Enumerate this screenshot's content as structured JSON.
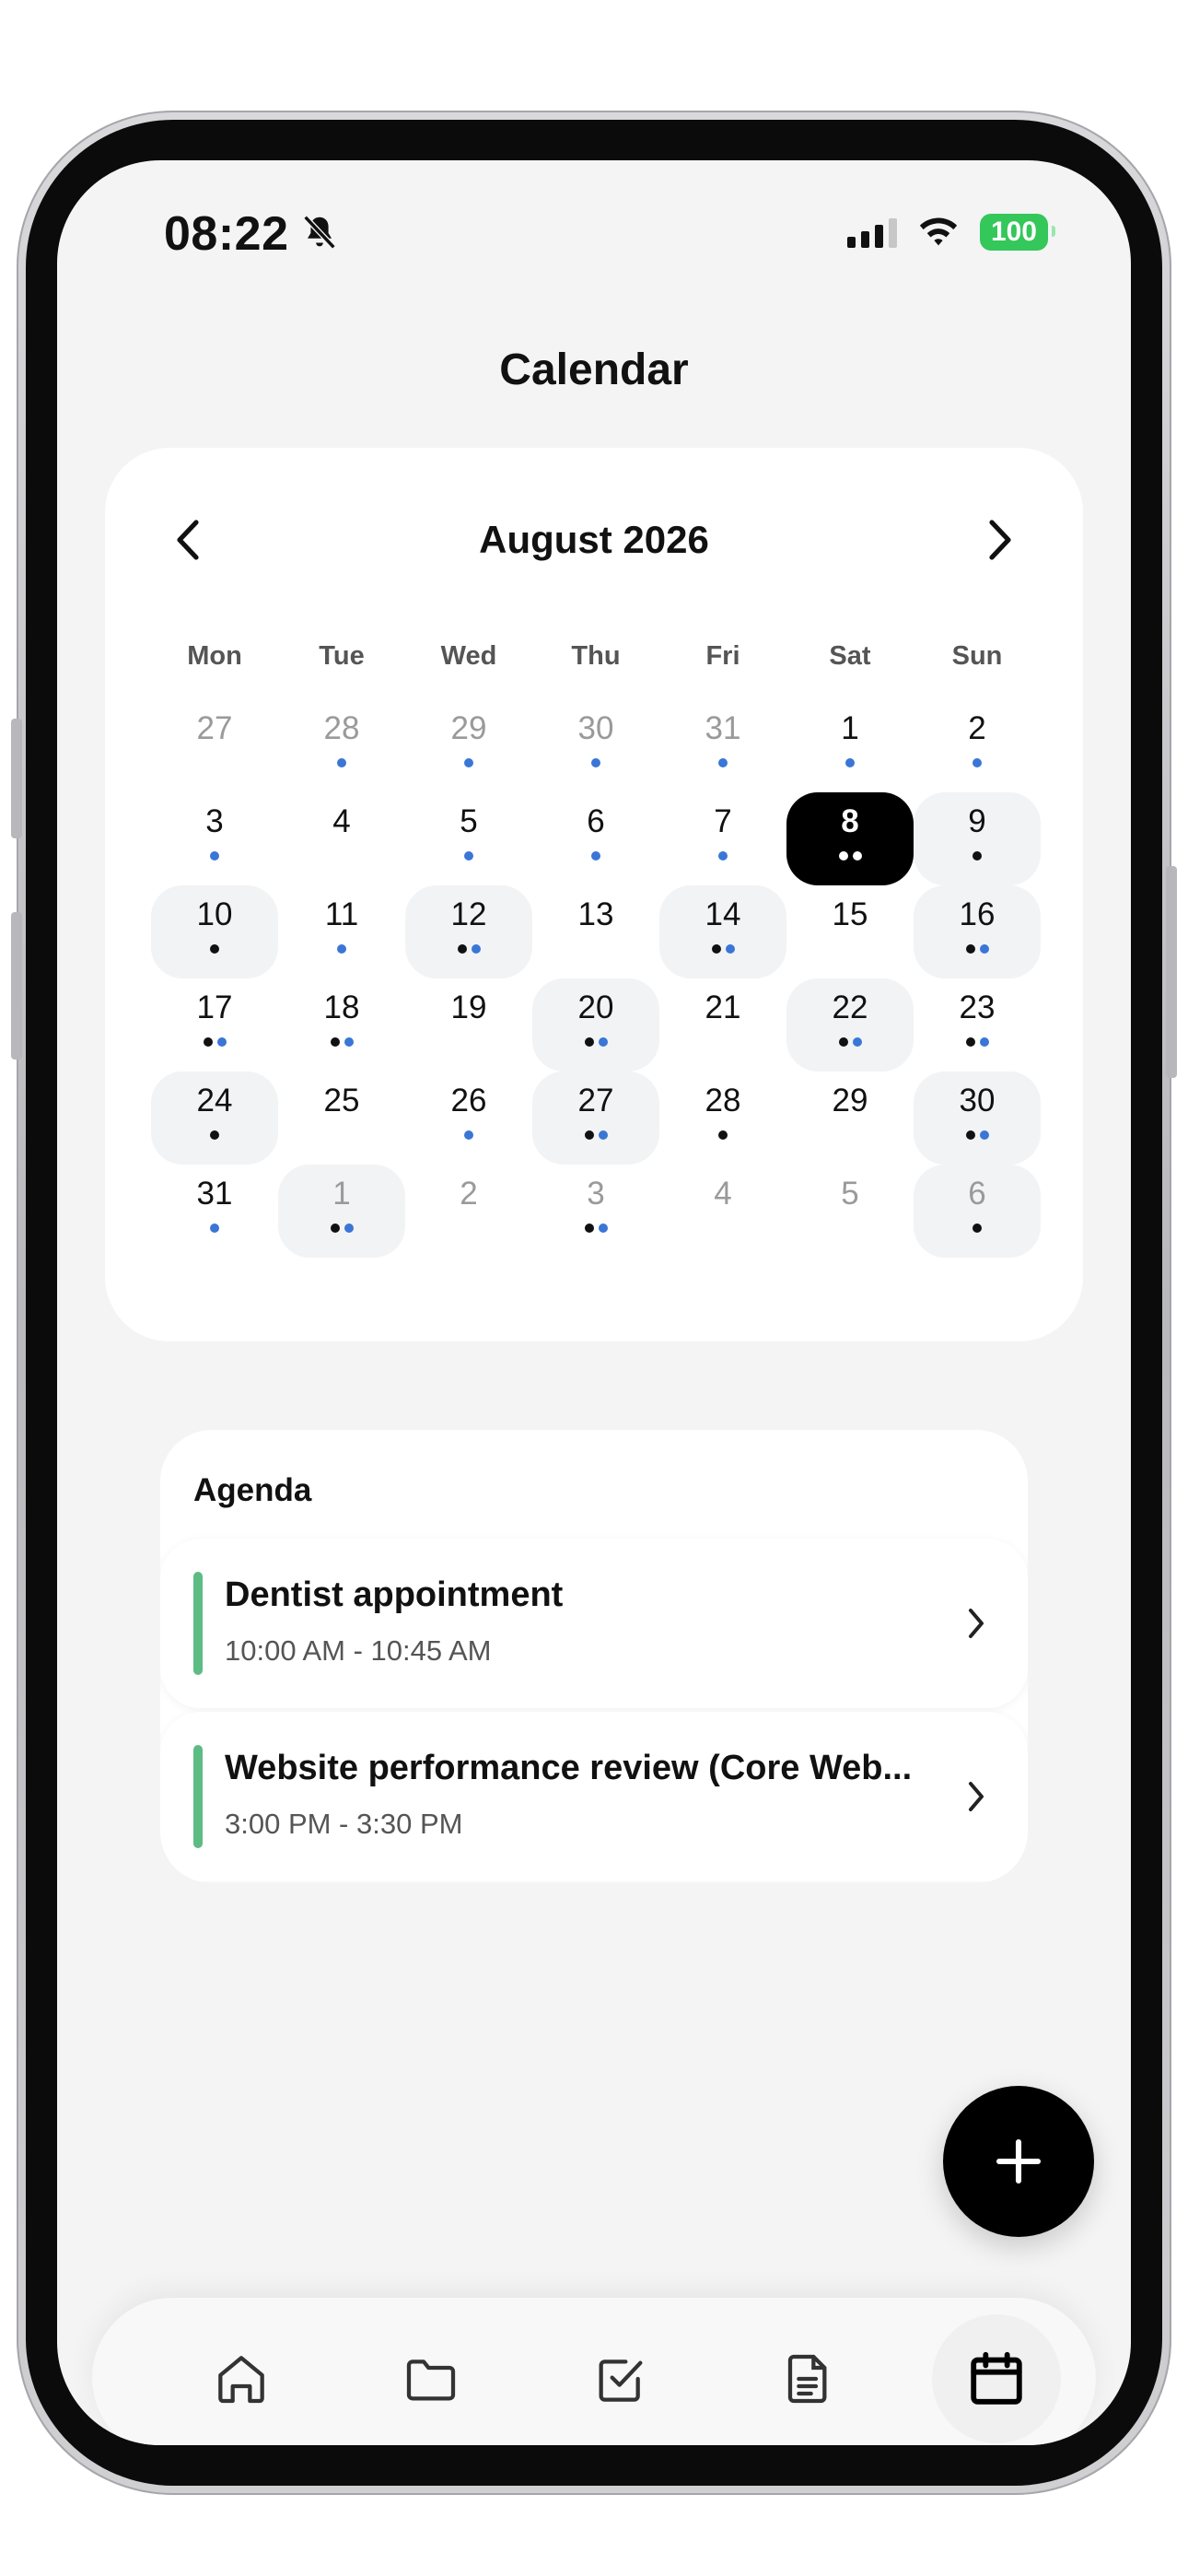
{
  "status_bar": {
    "time": "08:22",
    "battery": "100"
  },
  "page": {
    "title": "Calendar"
  },
  "calendar": {
    "month_label": "August 2026",
    "weekdays": [
      "Mon",
      "Tue",
      "Wed",
      "Thu",
      "Fri",
      "Sat",
      "Sun"
    ],
    "days": [
      {
        "label": "27",
        "out": true,
        "dots": []
      },
      {
        "label": "28",
        "out": true,
        "dots": [
          "blue"
        ]
      },
      {
        "label": "29",
        "out": true,
        "dots": [
          "blue"
        ]
      },
      {
        "label": "30",
        "out": true,
        "dots": [
          "blue"
        ]
      },
      {
        "label": "31",
        "out": true,
        "dots": [
          "blue"
        ]
      },
      {
        "label": "1",
        "dots": [
          "blue"
        ]
      },
      {
        "label": "2",
        "dots": [
          "blue"
        ]
      },
      {
        "label": "3",
        "dots": [
          "blue"
        ]
      },
      {
        "label": "4",
        "dots": []
      },
      {
        "label": "5",
        "dots": [
          "blue"
        ]
      },
      {
        "label": "6",
        "dots": [
          "blue"
        ]
      },
      {
        "label": "7",
        "dots": [
          "blue"
        ]
      },
      {
        "label": "8",
        "selected": true,
        "dots": [
          "black",
          "black"
        ]
      },
      {
        "label": "9",
        "shaded": true,
        "dots": [
          "black"
        ]
      },
      {
        "label": "10",
        "shaded": true,
        "dots": [
          "black"
        ]
      },
      {
        "label": "11",
        "dots": [
          "blue"
        ]
      },
      {
        "label": "12",
        "shaded": true,
        "dots": [
          "black",
          "blue"
        ]
      },
      {
        "label": "13",
        "dots": []
      },
      {
        "label": "14",
        "shaded": true,
        "dots": [
          "black",
          "blue"
        ]
      },
      {
        "label": "15",
        "dots": []
      },
      {
        "label": "16",
        "shaded": true,
        "dots": [
          "black",
          "blue"
        ]
      },
      {
        "label": "17",
        "dots": [
          "black",
          "blue"
        ]
      },
      {
        "label": "18",
        "dots": [
          "black",
          "blue"
        ]
      },
      {
        "label": "19",
        "dots": []
      },
      {
        "label": "20",
        "shaded": true,
        "dots": [
          "black",
          "blue"
        ]
      },
      {
        "label": "21",
        "dots": []
      },
      {
        "label": "22",
        "shaded": true,
        "dots": [
          "black",
          "blue"
        ]
      },
      {
        "label": "23",
        "dots": [
          "black",
          "blue"
        ]
      },
      {
        "label": "24",
        "shaded": true,
        "dots": [
          "black"
        ]
      },
      {
        "label": "25",
        "dots": []
      },
      {
        "label": "26",
        "dots": [
          "blue"
        ]
      },
      {
        "label": "27",
        "shaded": true,
        "dots": [
          "black",
          "blue"
        ]
      },
      {
        "label": "28",
        "dots": [
          "black"
        ]
      },
      {
        "label": "29",
        "dots": []
      },
      {
        "label": "30",
        "shaded": true,
        "dots": [
          "black",
          "blue"
        ]
      },
      {
        "label": "31",
        "dots": [
          "blue"
        ]
      },
      {
        "label": "1",
        "out": true,
        "shaded": true,
        "dots": [
          "black",
          "blue"
        ]
      },
      {
        "label": "2",
        "out": true,
        "dots": []
      },
      {
        "label": "3",
        "out": true,
        "dots": [
          "black",
          "blue"
        ]
      },
      {
        "label": "4",
        "out": true,
        "dots": []
      },
      {
        "label": "5",
        "out": true,
        "dots": []
      },
      {
        "label": "6",
        "out": true,
        "shaded": true,
        "dots": [
          "black"
        ]
      }
    ]
  },
  "agenda": {
    "title": "Agenda",
    "events": [
      {
        "title": "Dentist appointment",
        "time": "10:00 AM - 10:45 AM",
        "color": "#5dbb84"
      },
      {
        "title": "Website performance review (Core Web...",
        "time": "3:00 PM - 3:30 PM",
        "color": "#5dbb84"
      }
    ]
  },
  "tabs": [
    {
      "icon": "home-icon",
      "active": false
    },
    {
      "icon": "folder-icon",
      "active": false
    },
    {
      "icon": "checkbox-icon",
      "active": false
    },
    {
      "icon": "document-icon",
      "active": false
    },
    {
      "icon": "calendar-icon",
      "active": true
    }
  ],
  "colors": {
    "accent_dot": "#3a76d6",
    "event_bar": "#5dbb84",
    "selected_day": "#000000"
  }
}
